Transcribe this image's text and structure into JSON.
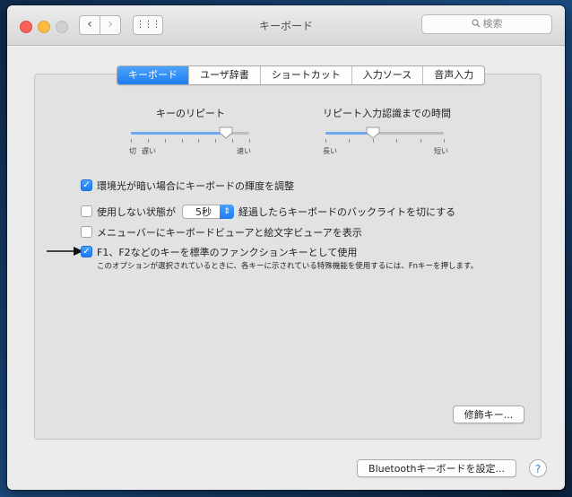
{
  "window": {
    "title": "キーボード",
    "search_placeholder": "検索",
    "back_symbol": "‹",
    "forward_symbol": "›",
    "grid_symbol": "⋮⋮⋮"
  },
  "tabs": [
    {
      "label": "キーボード",
      "active": true
    },
    {
      "label": "ユーザ辞書",
      "active": false
    },
    {
      "label": "ショートカット",
      "active": false
    },
    {
      "label": "入力ソース",
      "active": false
    },
    {
      "label": "音声入力",
      "active": false
    }
  ],
  "key_repeat": {
    "label": "キーのリピート",
    "min_label_off": "切",
    "min_label_slow": "遅い",
    "max_label": "速い",
    "value_fraction": 0.8
  },
  "delay_until_repeat": {
    "label": "リピート入力認識までの時間",
    "min_label": "長い",
    "max_label": "短い",
    "value_fraction": 0.4
  },
  "options": {
    "adjust_brightness": {
      "label": "環境光が暗い場合にキーボードの輝度を調整",
      "checked": true
    },
    "backlight_off": {
      "label_before": "使用しない状態が",
      "value": "5秒",
      "label_after": "経過したらキーボードのバックライトを切にする",
      "checked": false
    },
    "show_viewer": {
      "label": "メニューバーにキーボードビューアと絵文字ビューアを表示",
      "checked": false
    },
    "fn_keys": {
      "label": "F1、F2などのキーを標準のファンクションキーとして使用",
      "description": "このオプションが選択されているときに、各キーに示されている特殊機能を使用するには、Fnキーを押します。",
      "checked": true
    }
  },
  "buttons": {
    "modifier_keys": "修飾キー...",
    "bluetooth_setup": "Bluetoothキーボードを設定...",
    "help": "?"
  },
  "colors": {
    "accent": "#1c7ef2"
  }
}
